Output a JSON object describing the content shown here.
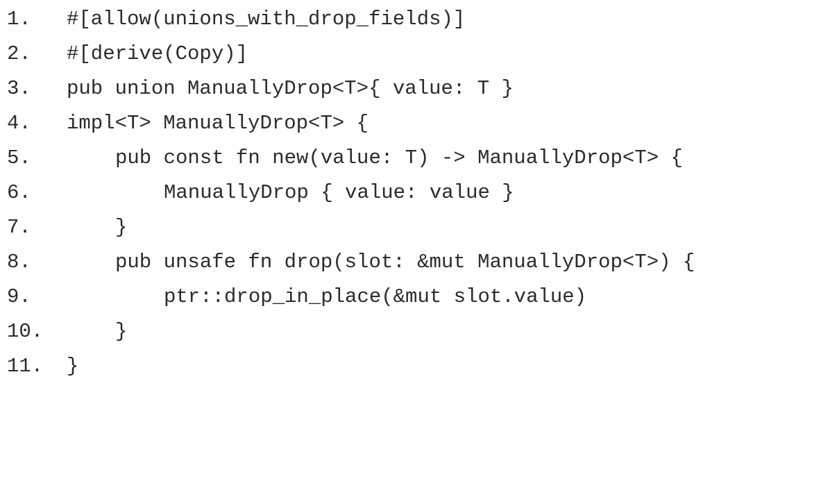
{
  "code": {
    "lines": [
      {
        "number": "1.",
        "text": "#[allow(unions_with_drop_fields)]"
      },
      {
        "number": "2.",
        "text": "#[derive(Copy)]"
      },
      {
        "number": "3.",
        "text": "pub union ManuallyDrop<T>{ value: T }"
      },
      {
        "number": "4.",
        "text": "impl<T> ManuallyDrop<T> {"
      },
      {
        "number": "5.",
        "text": "pub const fn new(value: T) -> ManuallyDrop<T> {"
      },
      {
        "number": "6.",
        "text": "ManuallyDrop { value: value }"
      },
      {
        "number": "7.",
        "text": "}"
      },
      {
        "number": "8.",
        "text": "pub unsafe fn drop(slot: &mut ManuallyDrop<T>) {"
      },
      {
        "number": "9.",
        "text": "ptr::drop_in_place(&mut slot.value)"
      },
      {
        "number": "10.",
        "text": "}"
      },
      {
        "number": "11.",
        "text": "}"
      }
    ]
  }
}
